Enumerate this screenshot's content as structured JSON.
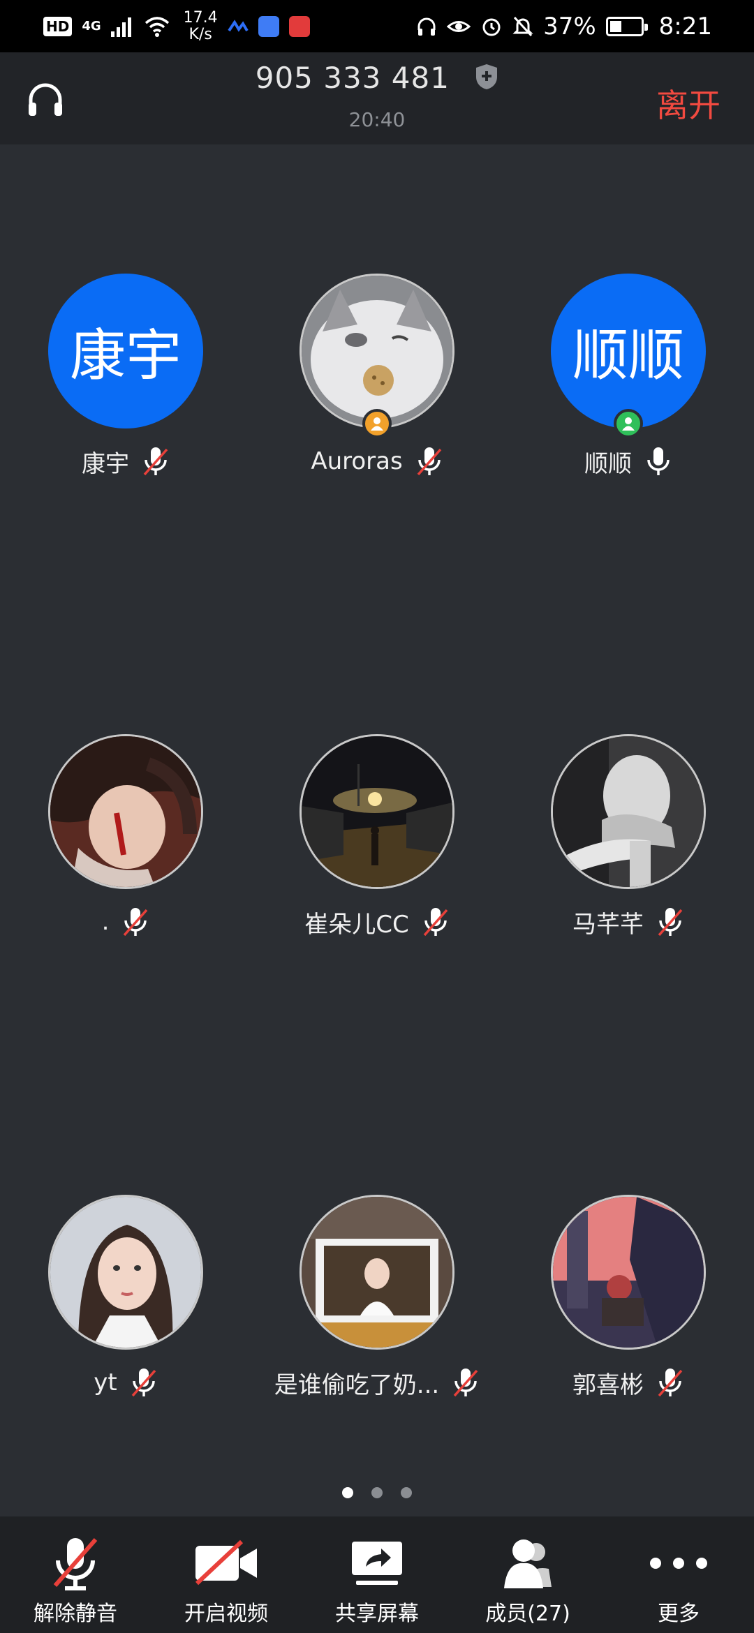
{
  "status_bar": {
    "hd": "HD",
    "network": "4G",
    "speed_value": "17.4",
    "speed_unit": "K/s",
    "battery": "37%",
    "time": "8:21"
  },
  "header": {
    "meeting_id": "905 333 481",
    "duration": "20:40",
    "leave_label": "离开"
  },
  "participants": [
    {
      "name": "康宇",
      "avatar_text": "康宇",
      "muted": true
    },
    {
      "name": "Auroras",
      "avatar_text": "",
      "muted": true,
      "badge": "host"
    },
    {
      "name": "顺顺",
      "avatar_text": "顺顺",
      "muted": false,
      "badge": "cohost"
    },
    {
      "name": ".",
      "avatar_text": "",
      "muted": true
    },
    {
      "name": "崔朵儿CC",
      "avatar_text": "",
      "muted": true
    },
    {
      "name": "马芊芊",
      "avatar_text": "",
      "muted": true
    },
    {
      "name": "yt",
      "avatar_text": "",
      "muted": true
    },
    {
      "name": "是谁偷吃了奶...",
      "avatar_text": "",
      "muted": true
    },
    {
      "name": "郭喜彬",
      "avatar_text": "",
      "muted": true
    }
  ],
  "pager": {
    "pages": 3,
    "current": 1
  },
  "toolbar": {
    "unmute": "解除静音",
    "start_video": "开启视频",
    "share_screen": "共享屏幕",
    "members": "成员(27)",
    "more": "更多"
  },
  "colors": {
    "background": "#2b2e33",
    "header": "#222428",
    "toolbar": "#1f2124",
    "avatar_blue": "#0a6cf5",
    "leave_red": "#f24a40",
    "host_badge": "#f2a12b",
    "cohost_badge": "#2fbf5a"
  }
}
